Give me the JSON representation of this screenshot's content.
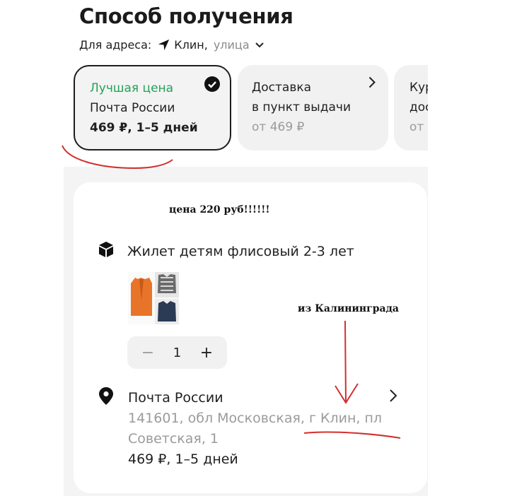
{
  "header": {
    "title": "Способ получения",
    "address_label": "Для адреса:",
    "address_city": "Клин,",
    "address_street": "улица"
  },
  "delivery_options": [
    {
      "tag": "Лучшая цена",
      "name": "Почта России",
      "price": "469 ₽, 1–5 дней",
      "selected": true
    },
    {
      "name_line1": "Доставка",
      "name_line2": "в пункт выдачи",
      "price": "от 469 ₽"
    },
    {
      "name_line1": "Кур",
      "name_line2": "дос",
      "price": "от"
    }
  ],
  "item": {
    "name": "Жилет детям флисовый 2-3 лет",
    "quantity": "1",
    "minus": "−",
    "plus": "+"
  },
  "pickup": {
    "name": "Почта России",
    "address": "141601, обл Московская, г Клин, пл Советская, 1",
    "price_time": "469 ₽, 1–5 дней"
  },
  "annotations": {
    "price_note": "цена 220 руб!!!!!!",
    "origin_note": "из Калининграда",
    "ink_color": "#d32f2f"
  },
  "colors": {
    "accent_green": "#23a25a",
    "muted_text": "#9b9b9b",
    "selected_border": "#1d1d1d"
  }
}
